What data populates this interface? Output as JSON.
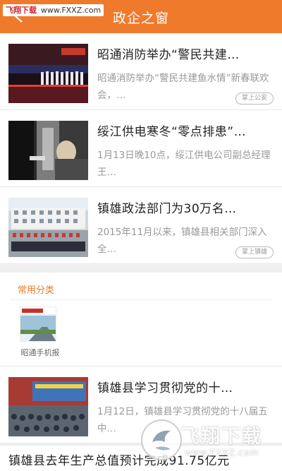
{
  "header": {
    "title": "政企之窗",
    "watermark_brand": "飞翔下载",
    "watermark_url": "www.FXXZ.com"
  },
  "news": [
    {
      "title": "昭通消防举办“警民共建…",
      "desc": "昭通消防举办“警民共建鱼水情”新春联欢会，…",
      "tag": "掌上公安"
    },
    {
      "title": "绥江供电寒冬“零点排患”…",
      "desc": "1月13日晚10点，绥江供电公司副总经理王…",
      "tag": ""
    },
    {
      "title": "镇雄政法部门为30万名…",
      "desc": "2015年11月以来，镇雄县相关部门深入全…",
      "tag": "掌上镇雄"
    },
    {
      "title": "镇雄县学习贯彻党的十…",
      "desc": "1月12日，镇雄县学习贯彻党的十八届五中…",
      "tag": ""
    }
  ],
  "category": {
    "title": "常用分类",
    "items": [
      {
        "label": "昭通手机报"
      }
    ]
  },
  "bottom_title": "镇雄县去年生产总值预计完成91.75亿元",
  "bottom_watermark": {
    "brand": "飞翔下载",
    "url": "www.FXXZ.com"
  }
}
